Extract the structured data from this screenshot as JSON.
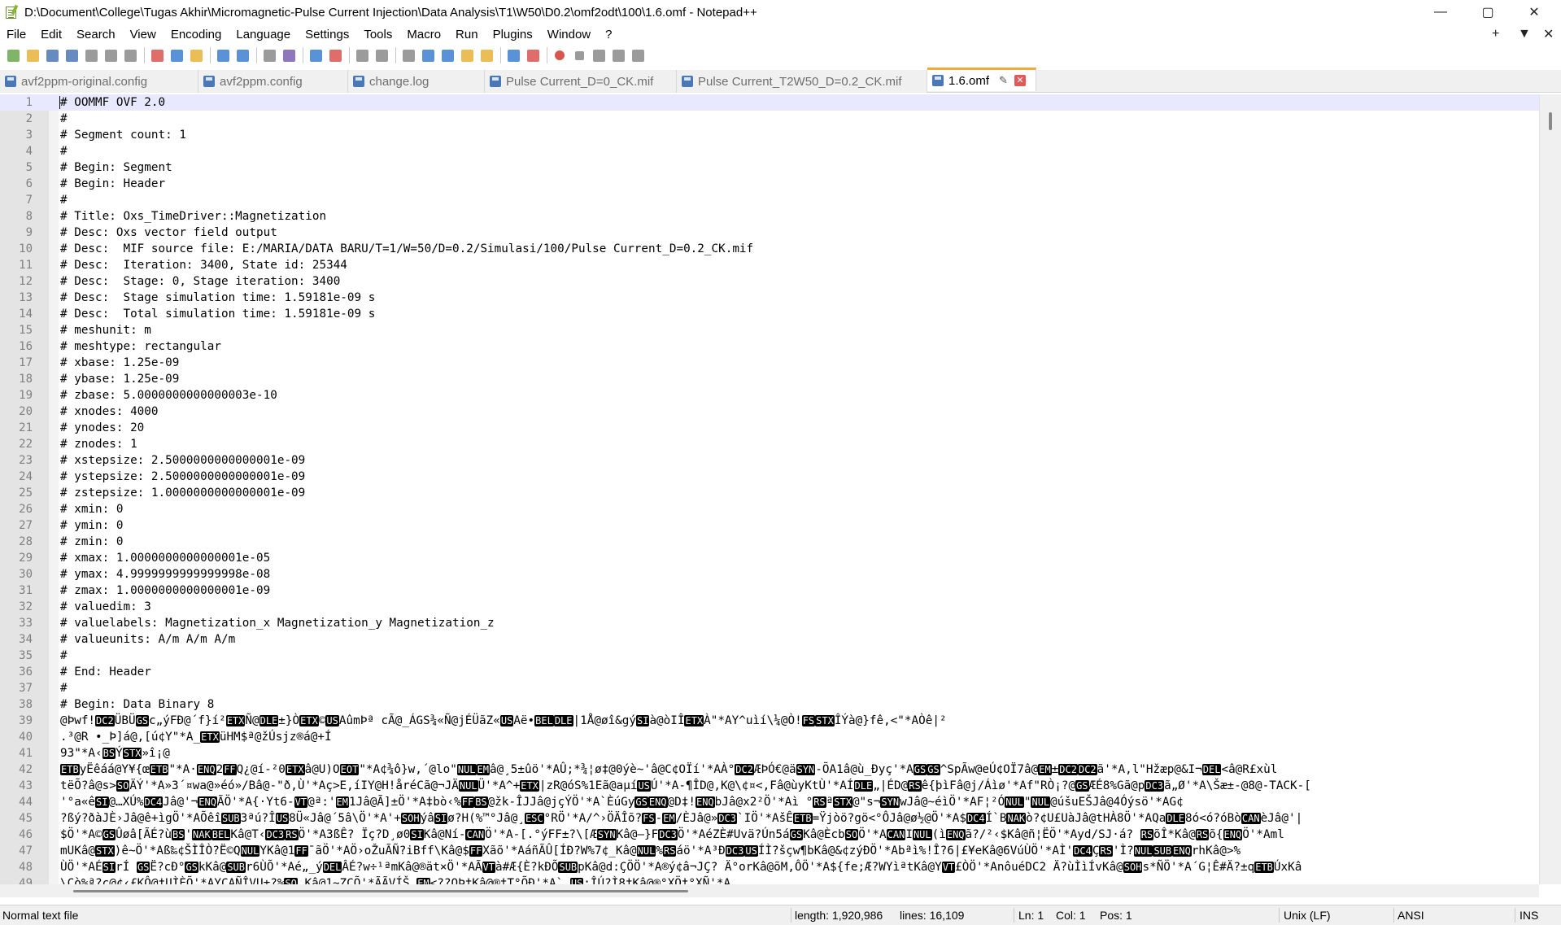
{
  "window": {
    "title": "D:\\Document\\College\\Tugas Akhir\\Micromagnetic-Pulse Current Injection\\Data Analysis\\T1\\W50\\D0.2\\omf2odt\\100\\1.6.omf - Notepad++",
    "controls": {
      "minimize": "—",
      "maximize": "▢",
      "close": "✕"
    }
  },
  "menu": {
    "items": [
      "File",
      "Edit",
      "Search",
      "View",
      "Encoding",
      "Language",
      "Settings",
      "Tools",
      "Macro",
      "Run",
      "Plugins",
      "Window",
      "?"
    ],
    "right": {
      "plus": "+",
      "dropdown": "▼",
      "close": "✕"
    }
  },
  "toolbar": {
    "icons": [
      "new-file",
      "open-file",
      "save",
      "save-all",
      "close",
      "close-all",
      "print",
      "cut",
      "copy",
      "paste",
      "undo",
      "redo",
      "find",
      "replace",
      "zoom-in",
      "zoom-out",
      "sync-vertical",
      "sync-horizontal",
      "word-wrap",
      "show-all-chars",
      "indent-guide",
      "document-map",
      "function-list",
      "folder-workspace",
      "monitoring",
      "record-macro",
      "stop-macro",
      "play-macro",
      "run-macro-multiple",
      "save-macro"
    ],
    "colors": {
      "new": "#6aa84f",
      "folder": "#e6b23a",
      "save": "#4a77b5",
      "red": "#d9534f",
      "gray": "#8a8a8a",
      "blue": "#3d7fd0",
      "purple": "#7b5fb0"
    }
  },
  "tabs": [
    {
      "label": "avf2ppm-original.config",
      "active": false
    },
    {
      "label": "avf2ppm.config",
      "active": false
    },
    {
      "label": "change.log",
      "active": false
    },
    {
      "label": "Pulse Current_D=0_CK.mif",
      "active": false
    },
    {
      "label": "Pulse Current_T2W50_D=0.2_CK.mif",
      "active": false
    },
    {
      "label": "1.6.omf",
      "active": true,
      "pin": "✎",
      "close": "✕"
    }
  ],
  "editor": {
    "lines": [
      "# OOMMF OVF 2.0",
      "#",
      "# Segment count: 1",
      "#",
      "# Begin: Segment",
      "# Begin: Header",
      "#",
      "# Title: Oxs_TimeDriver::Magnetization",
      "# Desc: Oxs vector field output",
      "# Desc:  MIF source file: E:/MARIA/DATA BARU/T=1/W=50/D=0.2/Simulasi/100/Pulse Current_D=0.2_CK.mif",
      "# Desc:  Iteration: 3400, State id: 25344",
      "# Desc:  Stage: 0, Stage iteration: 3400",
      "# Desc:  Stage simulation time: 1.59181e-09 s",
      "# Desc:  Total simulation time: 1.59181e-09 s",
      "# meshunit: m",
      "# meshtype: rectangular",
      "# xbase: 1.25e-09",
      "# ybase: 1.25e-09",
      "# zbase: 5.0000000000000003e-10",
      "# xnodes: 4000",
      "# ynodes: 20",
      "# znodes: 1",
      "# xstepsize: 2.5000000000000001e-09",
      "# ystepsize: 2.5000000000000001e-09",
      "# zstepsize: 1.0000000000000001e-09",
      "# xmin: 0",
      "# ymin: 0",
      "# zmin: 0",
      "# xmax: 1.0000000000000001e-05",
      "# ymax: 4.9999999999999998e-08",
      "# zmax: 1.0000000000000001e-09",
      "# valuedim: 3",
      "# valuelabels: Magnetization_x Magnetization_y Magnetization_z",
      "# valueunits: A/m A/m A/m",
      "#",
      "# End: Header",
      "#",
      "# Begin: Data Binary 8",
      "@Þwf![DC2]ÜBÜ[GS]c„ýFÐ@´f}í²[ETX]Ñ@[DLE]±}Ò[ETX]©[US]AûmÞª cÃ@_ÁGS¾«Ñ@jÉÜãZ«[US]Aë•[BEL][DLE]|1Å@øî&gý[SI]à@òIÎ[ETX]À\"*AY^uìí\\¼@Ò![FS][STX]ÎÝà@}fê,<\"*AÒê|²",
      ".³@R •_Þ]á@,[ú¢Y\"*A_[ETX]üHM$ª@žÚsjz®á@+Í",
      "93\"*A‹[BS]Ý[STX]»î¡@",
      "[ETB]yËêáá@Y¥{œ[ETB]\"*A·[ENQ]2[FF]Q¿@í-²0[ETX]â@U)O[EOT]\"*A¢¾ô}w,´@lo\"[NUL][EM]â@¸5±ûö'*AÛ;*¾¦ø‡@0ýè~'â@C¢OÏí'*AÀ°[DC2]ÆÞÓ€@ä[SYN]-ÕA1â@ù_Ðyç'*A[GS][GS]^SpÃw@eÚ¢OÏ7â@[EM]±[DC2][DC2]ã'*A,l\"Hžæp@&I¬[DEL]<â@R£xùl",
      "tëÕ?â@s>[SO]ÄÝ'*A»3´¤wa@»éó»/Bâ@-\"ð,Ù'*Aç>E,íIY@H!åréCã@¬JÄ[NUL]Ü'*A^+[ETX]|zR@óS%1Eã@aµí[US]Ú'*A-¶ÎD@,K@\\¢¤<,Fâ@ùyKtÙ'*AÍ[DLE]„|ÉD@[RS]ê{þìFâ@j/Áìø'*Af\"RÒ¡?@[GS]ÆÉ8%Gã@p[DC3]ã„Ø'*A\\Šæ±-@8@-TACK-[",
      "'°a«ê[SI]@…XÚ%[DC4]Jâ@'¬[ENQ]ÃÖ'*A{·Yt6-[VT]@ª:'[EM]1Jâ@Ã]±Ö'*A‡bò‹%[FF][BS]@žk-ÎJJâ@jçÝÖ'*A`ÈúGy[GS][ENQ]@D‡![ENQ]bJâ@x2²Ö'*Aì °[RS]ª[STX]@\"s¬[SYN]wJâ@~éìÖ'*AF¦²Ó[NUL]\"[NUL]@úšuEŠJâ@4Óýsö'*AG¢",
      "?ßý?ðàJÈ›Jâ@ê+ìgÖ'*AÕêî[SUB]3ªú?Î[US]8Ü«Jâ@´5â\\Ö'*A'+[SOH]ýâ[SI]ø?H(%™°Jâ@¸[ESC]°RÖ'*A/^›ÖÄÎõ?[FS]-[EM]/ÈJâ@»[DC3]`IÖ'*AšÊ[ETB]=Ÿjòö?gö<°ÔJâ@ø½@Ö'*A$[DC4]Í`B[NAK]ò?¢U£UàJâ@tHÀ8Ö'*AQa[DLE]8ó<ó?óBò[CAN]èJâ@'|",
      "$Ö'*A©[GS]Ûøâ[ÃÉ?ù[BS]'[NAK][BEL]Kâ@T‹[DC3][RS]Ö'*A3ßÊ? Ïç?D¸ø0[SI]Kâ@Ní-[CAN]Ö'*A-[.°ýFF±?\\[Æ[SYN]Kâ@—}F[DC3]Ö'*AéZÈ#Uvä?Ún5á[GS]Kâ@Ècb[SO]Ö'*A[CAN]I[NUL](ì[ENQ]ã?/²‹$Kâ@ñ¦ËÖ'*Ayd/SJ·á? [RS]õÎ*Kâ@[RS]õ{[ENQ]Ö'*Aml",
      "mUKâ@[STX])ê~Ö'*Aß‰¢ŠÌÎÒ?Ë©Q[NUL]YKâ@1[FF]¯ãÖ'*AÖ›oŽuÃÑ?iBff\\Kâ@$[FF]Xãõ'*AáñÃÛ[ÍÐ?W%7¢_Kâ@[NUL]%[RS]áö'*A³Ð[DC3][US]ÍÌ?šçw¶bKâ@&¢zýÐÖ'*Abªì%!Î?6|£¥eKâ@6VúÙÖ'*AÌ'[DC4]Ç[RS]'Ì?[NUL][SUB][ENQ]rhKâ@>%",
      "ÙÖ'*AÉ[SI]rÍ [GS]Ë?cÐ°[GS]kKâ@[SUB]r6ÙÕ'*Aé„_ý[DEL]ÂÉ?w÷¹ªmKâ@®ät×Ö'*AÃ[VT]à#Æ{È?kÐÕ[SUB]pKâ@d:ÇÖÖ'*A®ý¢â¬JÇ? Ä°orKâ@õM,ÔÖ'*A${fe;Æ?WYìªtKâ@Y[VT]£ÒÖ'*AnôuéDC2 Ä?ùÌìÍvKâ@[SOH]s*ÑÖ'*A´G¦Ê#Ä?±q[ETB]ÚxKâ",
      "\\Cò%ª?ç@¢‹£KÔ@‡UÌÈÕ'*AYCAÑÎVU±?%[SO] Kâ@1~ZCÕ'*ÃÃVÍŠ [EM]<??OÞ‡Kâ@®‡T°ÕÐ'*A` [US]:ÎÚ?Ì8‡Kâ@®°XÖ‡°XÑ'*A"
    ]
  },
  "status": {
    "file_type": "Normal text file",
    "length": "length: 1,920,986",
    "lines": "lines: 16,109",
    "ln": "Ln: 1",
    "col": "Col: 1",
    "pos": "Pos: 1",
    "eol": "Unix (LF)",
    "encoding": "ANSI",
    "mode": "INS"
  }
}
